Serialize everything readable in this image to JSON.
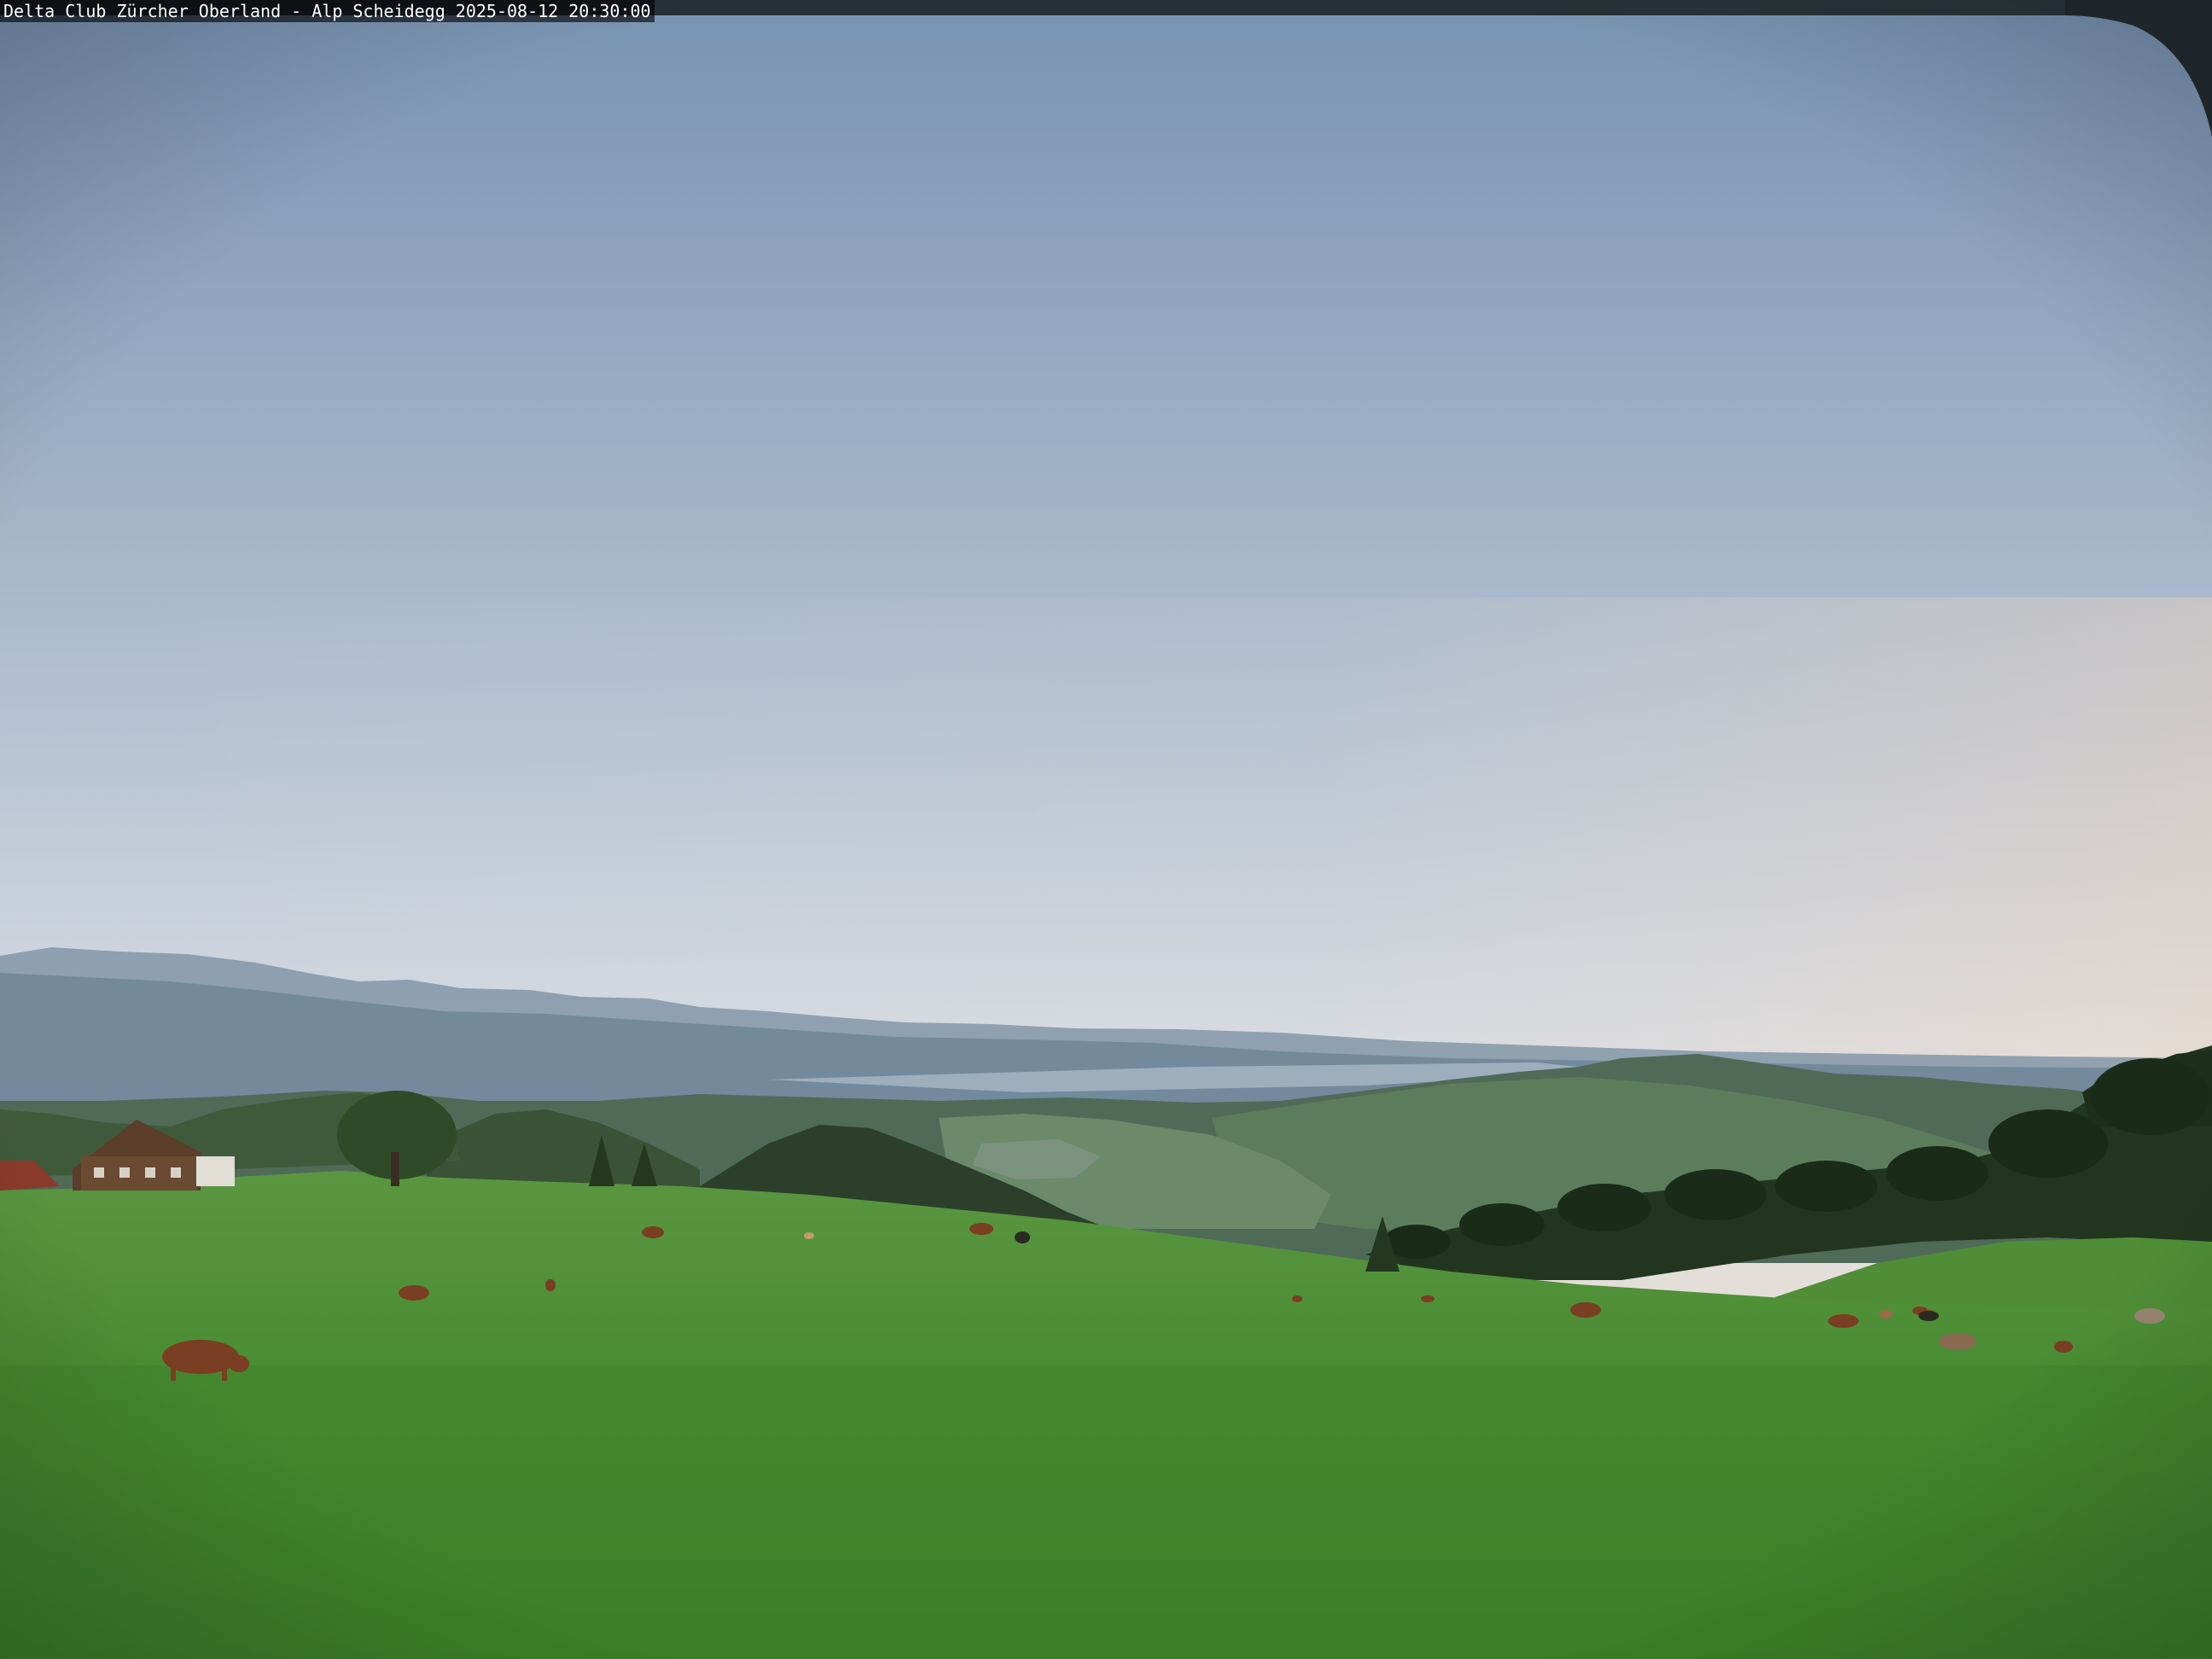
{
  "overlay": {
    "caption": "Delta Club Zürcher Oberland - Alp Scheidegg 2025-08-12 20:30:00"
  },
  "scene": {
    "colors": {
      "sky_top": "#7f9bb8",
      "sky_mid": "#c9d3df",
      "sky_horizon": "#f2dcc8",
      "far_mountains": "#6f8598",
      "mid_hills": "#4f6a5a",
      "forest": "#22361f",
      "meadow_near": "#3f8a2c",
      "meadow_far": "#5f9a42",
      "cattle_brown": "#7a3e22"
    }
  }
}
